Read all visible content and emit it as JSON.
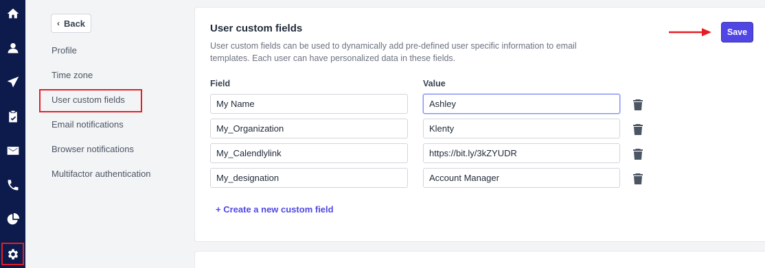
{
  "rail": {
    "items": [
      {
        "icon": "home-icon"
      },
      {
        "icon": "user-icon"
      },
      {
        "icon": "send-icon"
      },
      {
        "icon": "clipboard-check-icon"
      },
      {
        "icon": "mail-icon"
      },
      {
        "icon": "phone-icon"
      },
      {
        "icon": "pie-chart-icon"
      },
      {
        "icon": "gear-icon"
      }
    ]
  },
  "subnav": {
    "back_label": "Back",
    "items": [
      {
        "label": "Profile"
      },
      {
        "label": "Time zone"
      },
      {
        "label": "User custom fields"
      },
      {
        "label": "Email notifications"
      },
      {
        "label": "Browser notifications"
      },
      {
        "label": "Multifactor authentication"
      }
    ]
  },
  "main": {
    "title": "User custom fields",
    "description": "User custom fields can be used to dynamically add pre-defined user specific information to email templates. Each user can have personalized data in these fields.",
    "save_label": "Save",
    "field_header": "Field",
    "value_header": "Value",
    "rows": [
      {
        "field": "My Name",
        "value": "Ashley"
      },
      {
        "field": "My_Organization",
        "value": "Klenty"
      },
      {
        "field": "My_Calendlylink",
        "value": "https://bit.ly/3kZYUDR"
      },
      {
        "field": "My_designation",
        "value": "Account Manager"
      }
    ],
    "create_label": "+ Create a new custom field"
  },
  "colors": {
    "rail_bg": "#0d1b4c",
    "accent": "#4f46e5",
    "highlight": "#e41e26"
  }
}
